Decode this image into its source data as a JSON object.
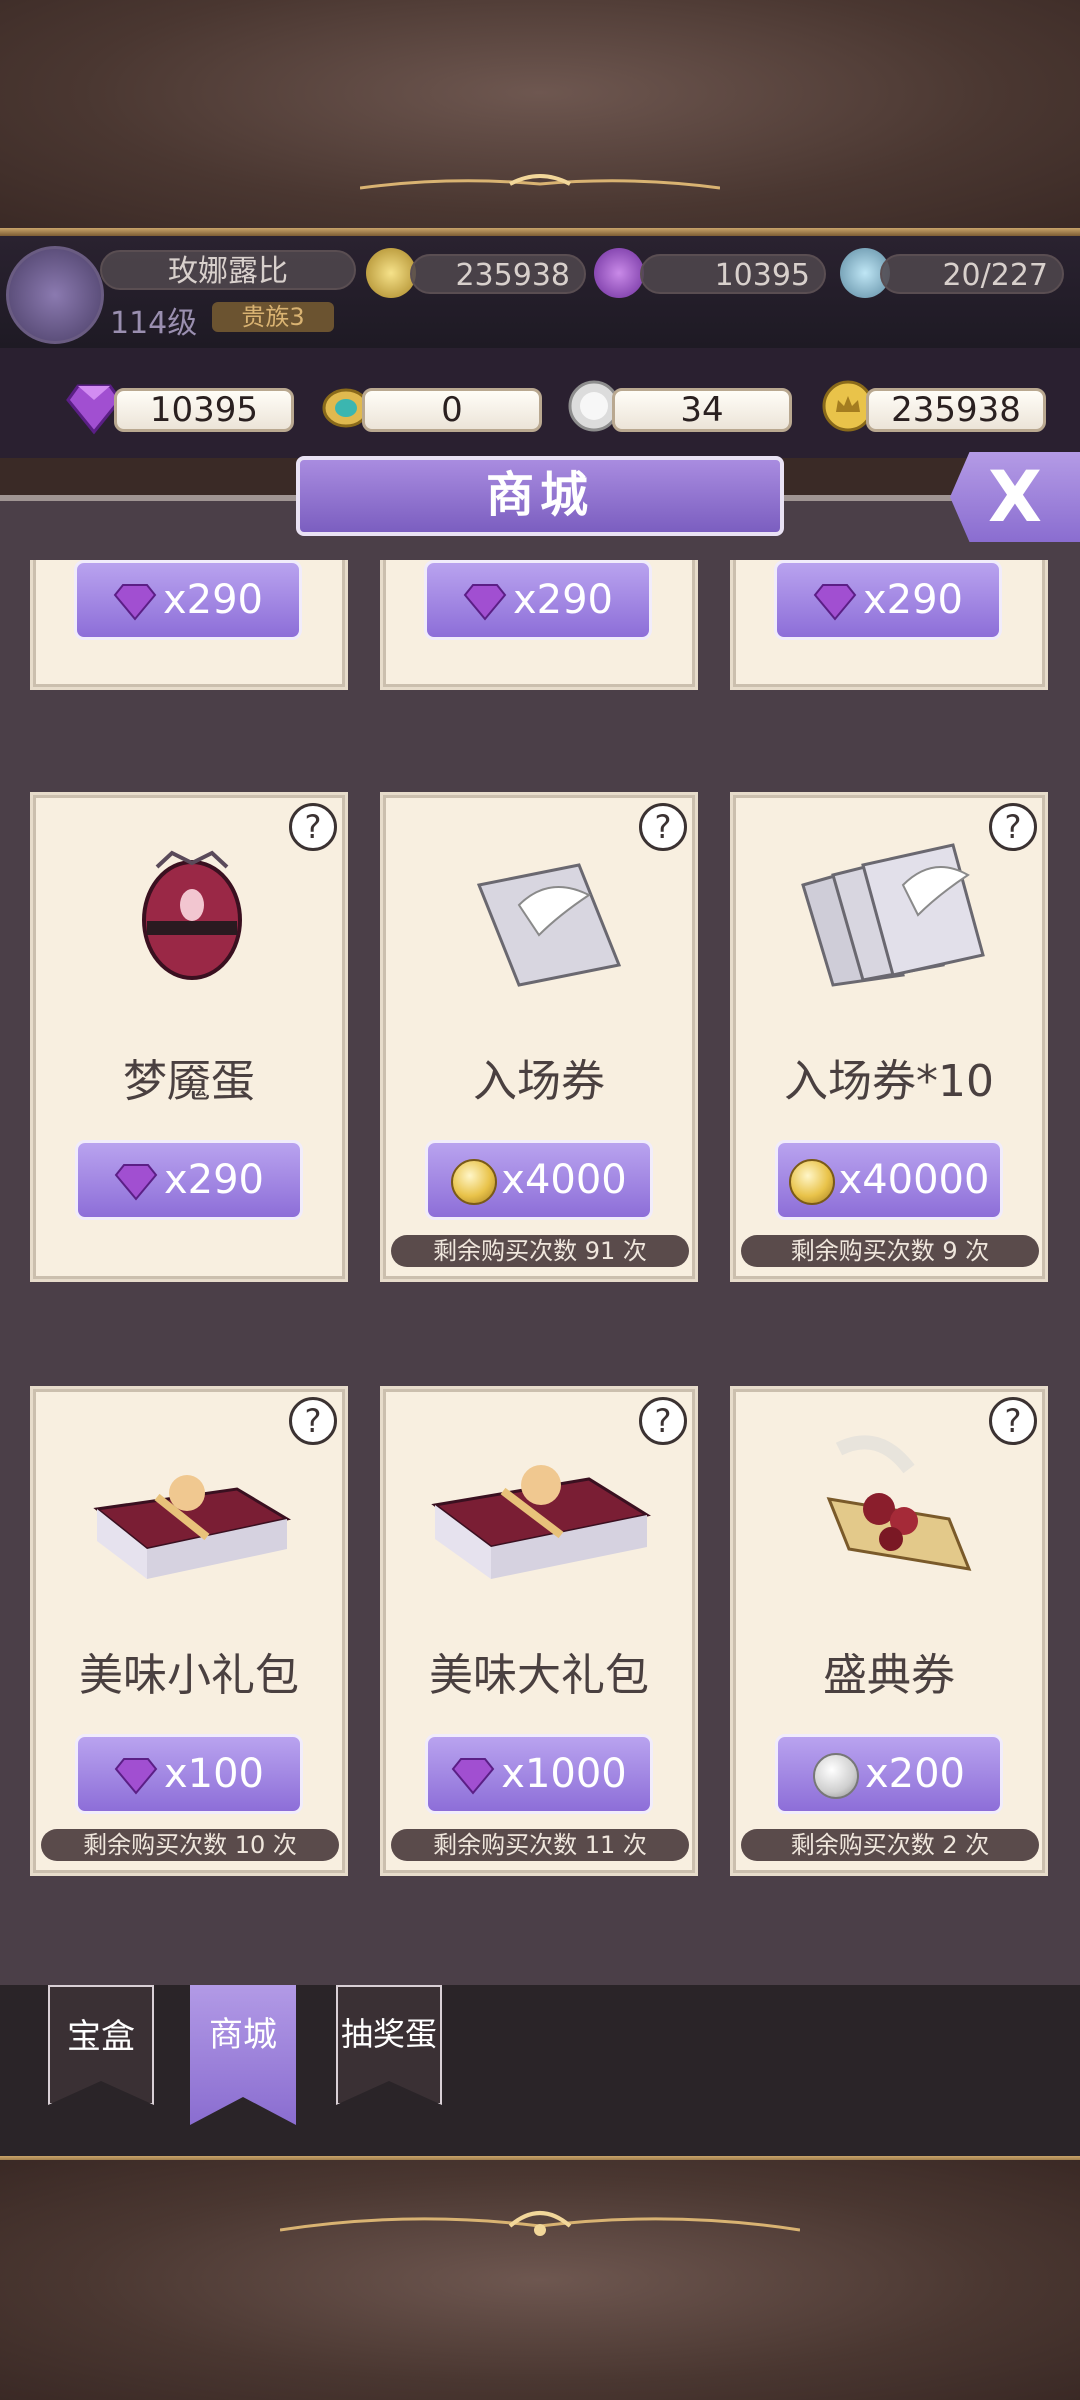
{
  "header": {
    "player_name": "玫娜露比",
    "level": "114级",
    "rank": "贵族3",
    "gold": "235938",
    "gems": "10395",
    "tickets": "20/227"
  },
  "currency": {
    "gems": "10395",
    "pendant": "0",
    "silver": "34",
    "gold": "235938"
  },
  "shop": {
    "title": "商城",
    "close_label": "X",
    "top_row_prices": [
      "x290",
      "x290",
      "x290"
    ],
    "items": [
      {
        "name": "梦魇蛋",
        "price": "x290",
        "currency_icon": "gem-icon",
        "remaining": ""
      },
      {
        "name": "入场券",
        "price": "x4000",
        "currency_icon": "gold-coin-icon",
        "remaining": "剩余购买次数 91 次"
      },
      {
        "name": "入场券*10",
        "price": "x40000",
        "currency_icon": "gold-coin-icon",
        "remaining": "剩余购买次数 9 次"
      },
      {
        "name": "美味小礼包",
        "price": "x100",
        "currency_icon": "gem-icon",
        "remaining": "剩余购买次数 10 次"
      },
      {
        "name": "美味大礼包",
        "price": "x1000",
        "currency_icon": "gem-icon",
        "remaining": "剩余购买次数 11 次"
      },
      {
        "name": "盛典券",
        "price": "x200",
        "currency_icon": "silver-coin-icon",
        "remaining": "剩余购买次数 2 次"
      }
    ],
    "help_label": "?"
  },
  "tabs": [
    {
      "label": "宝盒",
      "active": false
    },
    {
      "label": "商城",
      "active": true
    },
    {
      "label": "抽奖蛋",
      "active": false
    }
  ],
  "colors": {
    "accent": "#8d6ed8",
    "card": "#f8efe0",
    "panel": "#4b3f48"
  }
}
